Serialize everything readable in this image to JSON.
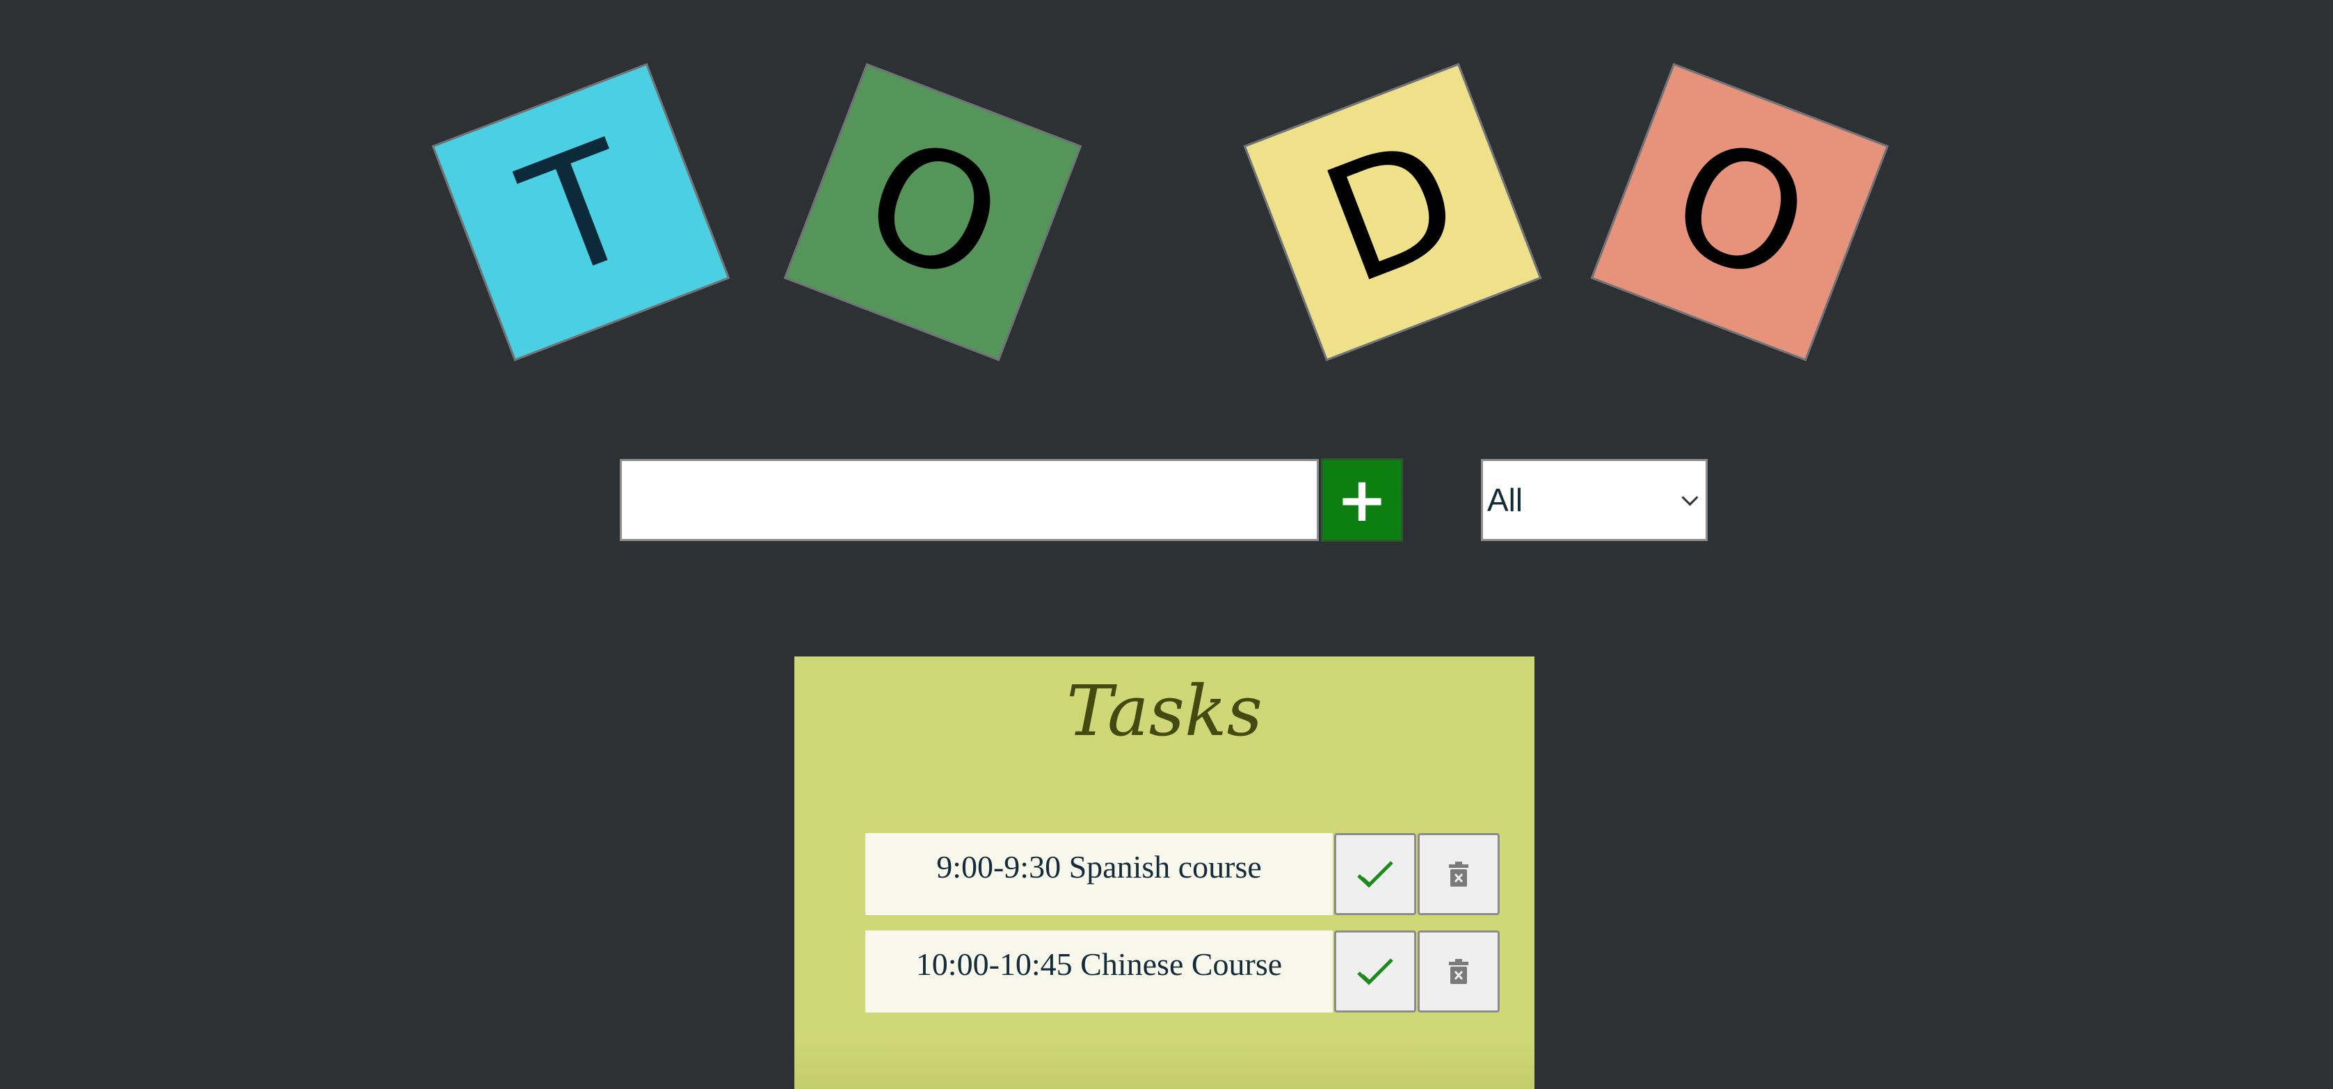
{
  "title_tiles": [
    {
      "letter": "T",
      "bg_color": "#4bd0e3",
      "text_color": "#0d2a3a"
    },
    {
      "letter": "O",
      "bg_color": "#56955a",
      "text_color": "#000000"
    },
    {
      "letter": "D",
      "bg_color": "#efe08a",
      "text_color": "#000000"
    },
    {
      "letter": "O",
      "bg_color": "#e7937b",
      "text_color": "#000000"
    }
  ],
  "input": {
    "value": "",
    "placeholder": ""
  },
  "add_button": {
    "label": "+",
    "color": "#0c7e12"
  },
  "filter": {
    "selected": "All"
  },
  "tasks_panel": {
    "title": "Tasks",
    "bg_color": "#d0d776",
    "title_color": "#424a12"
  },
  "tasks": [
    {
      "text": "9:00-9:30 Spanish course",
      "complete_icon": "check-icon",
      "delete_icon": "trash-icon"
    },
    {
      "text": "10:00-10:45 Chinese Course",
      "complete_icon": "check-icon",
      "delete_icon": "trash-icon"
    }
  ]
}
